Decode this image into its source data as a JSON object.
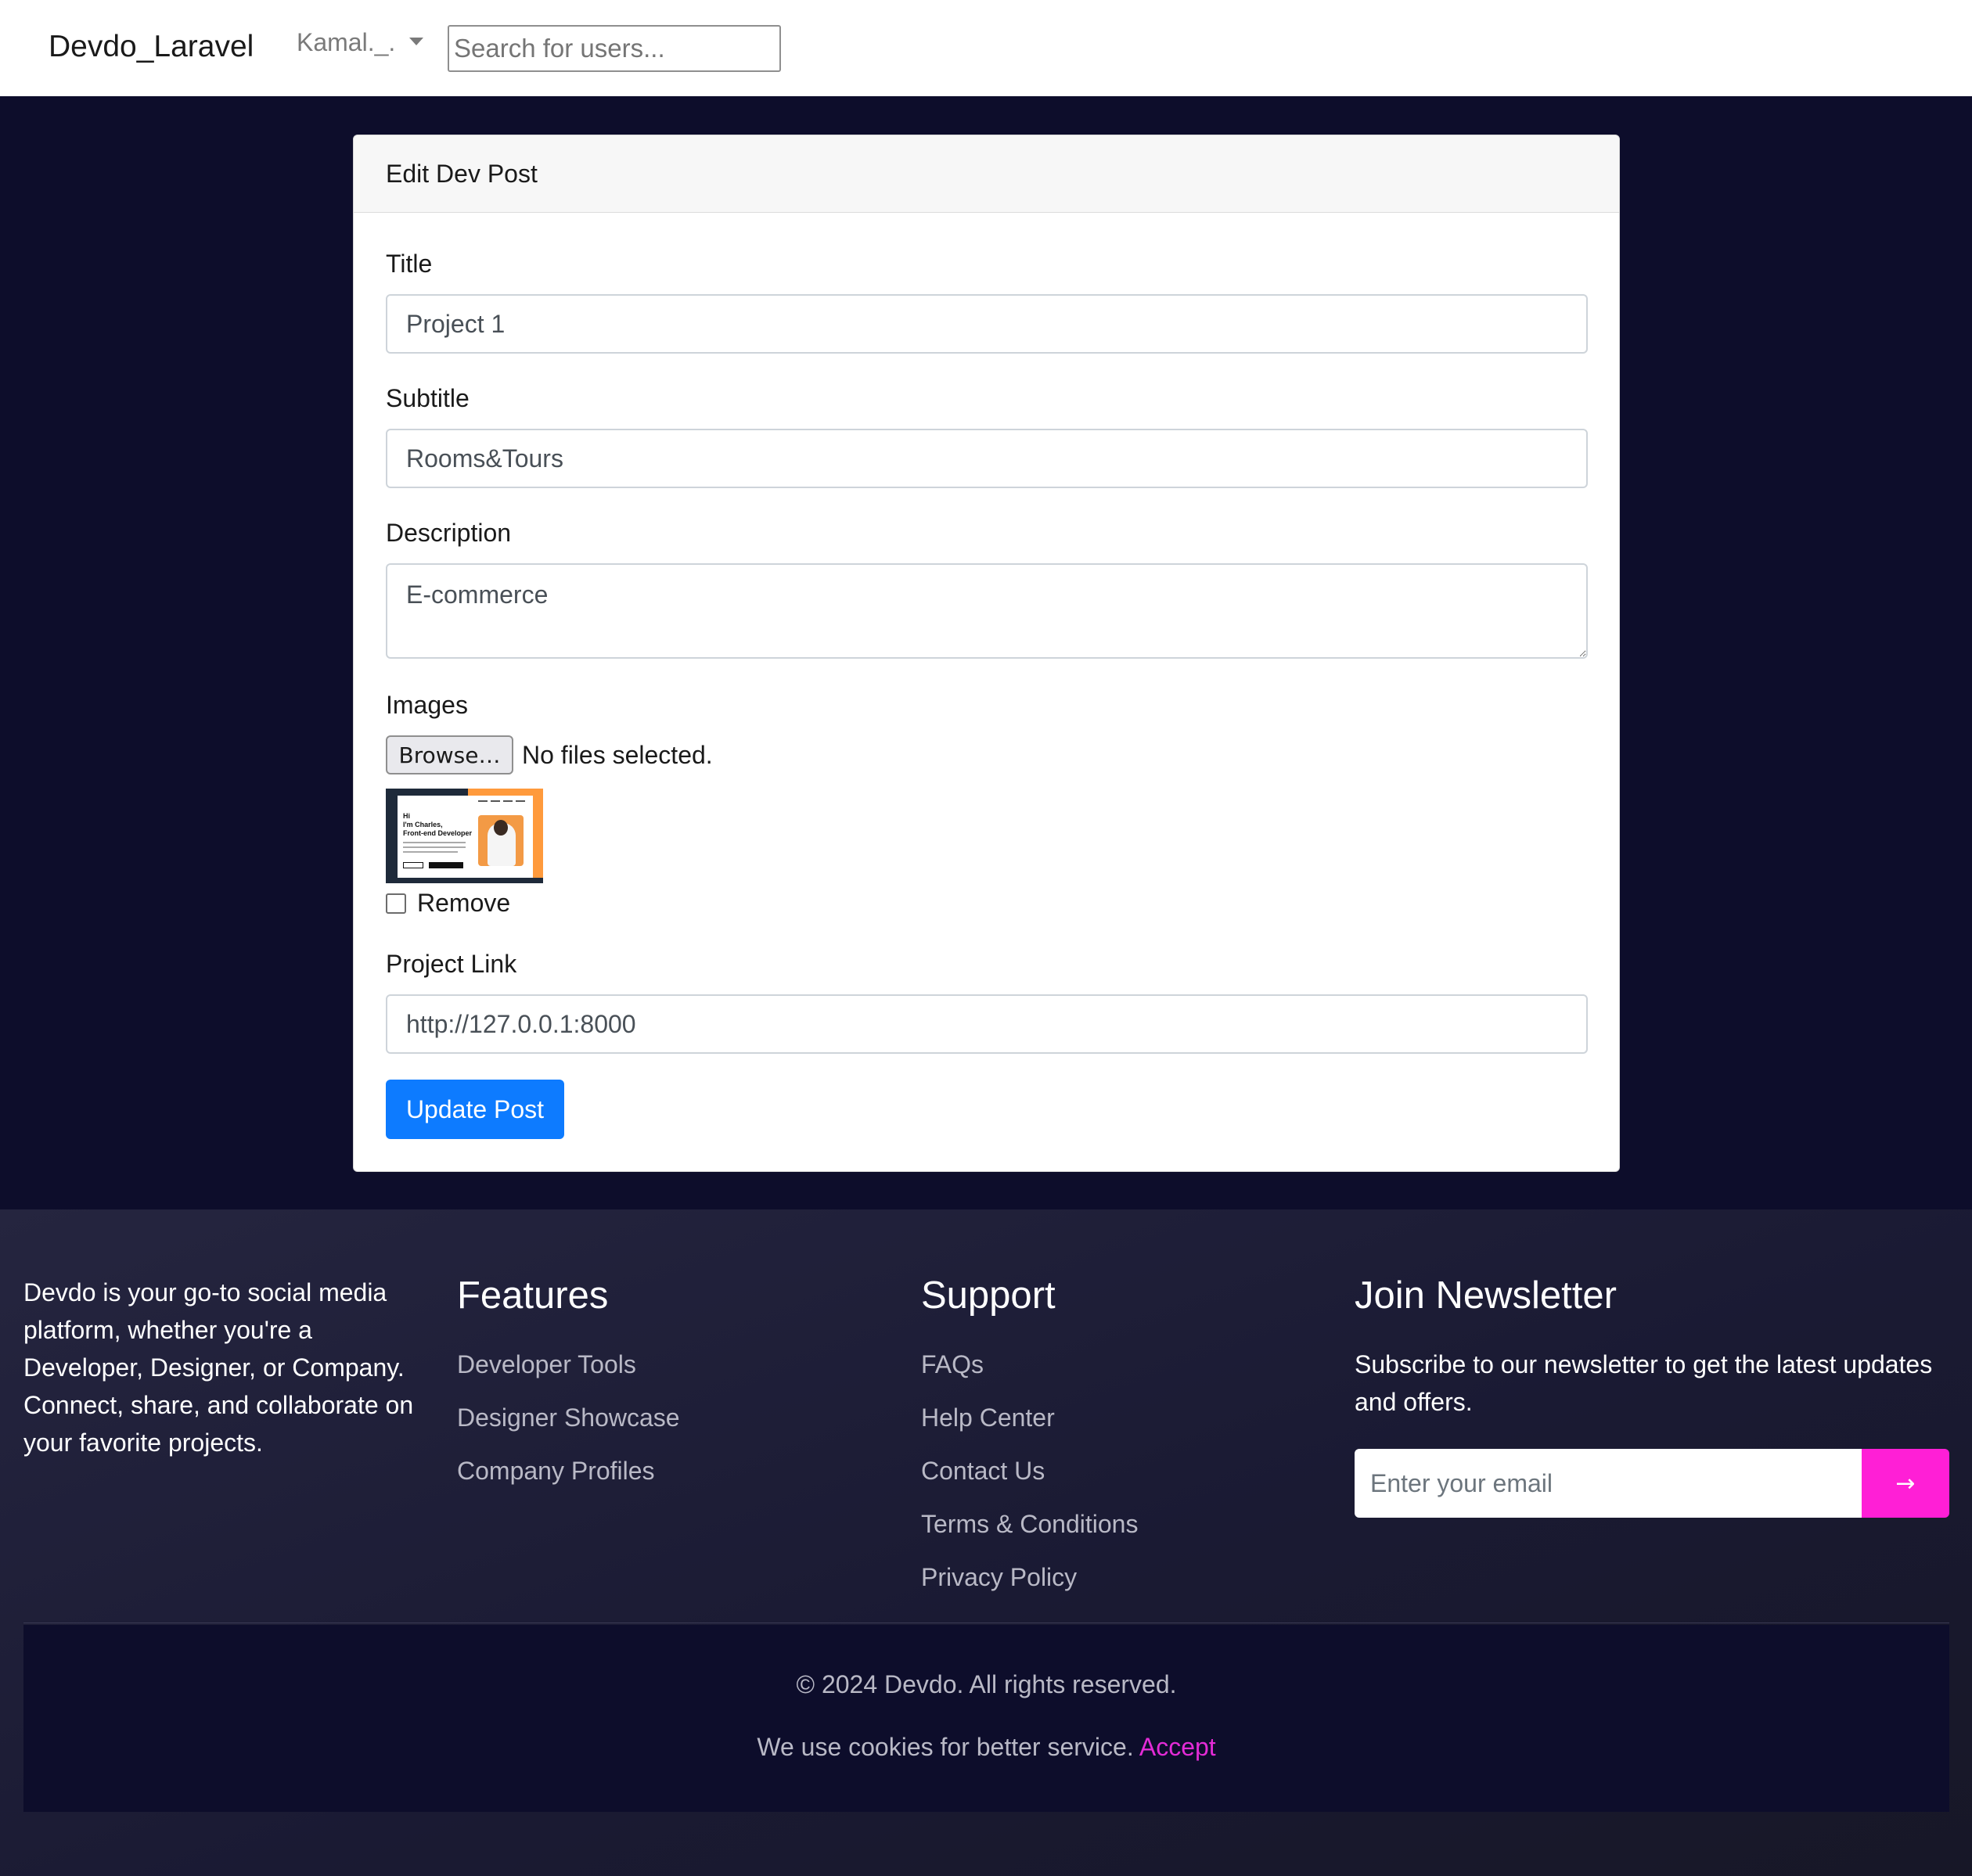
{
  "navbar": {
    "brand": "Devdo_Laravel",
    "user": "Kamal._.",
    "search_placeholder": "Search for users..."
  },
  "card": {
    "header": "Edit Dev Post",
    "title_label": "Title",
    "title_value": "Project 1",
    "subtitle_label": "Subtitle",
    "subtitle_value": "Rooms&Tours",
    "description_label": "Description",
    "description_value": "E-commerce",
    "images_label": "Images",
    "browse_label": "Browse…",
    "file_status": "No files selected.",
    "remove_label": "Remove",
    "remove_checked": false,
    "link_label": "Project Link",
    "link_value": "http://127.0.0.1:8000",
    "submit_label": "Update Post",
    "submit_color": "#0d7bff"
  },
  "thumbnail": {
    "greeting": "Hi",
    "line1": "I'm Charles,",
    "line2": "Front-end Developer"
  },
  "footer": {
    "about": "Devdo is your go-to social media platform, whether you're a Developer, Designer, or Company. Connect, share, and collaborate on your favorite projects.",
    "features": {
      "title": "Features",
      "links": [
        "Developer Tools",
        "Designer Showcase",
        "Company Profiles"
      ]
    },
    "support": {
      "title": "Support",
      "links": [
        "FAQs",
        "Help Center",
        "Contact Us",
        "Terms & Conditions",
        "Privacy Policy"
      ]
    },
    "newsletter": {
      "title": "Join Newsletter",
      "text": "Subscribe to our newsletter to get the latest updates and offers.",
      "email_placeholder": "Enter your email",
      "button_label": "→",
      "button_color": "#ff1fd6"
    },
    "copyright": "© 2024 Devdo. All rights reserved.",
    "cookie_text": "We use cookies for better service.",
    "cookie_accept": "Accept",
    "accent_color": "#e32bd6"
  },
  "colors": {
    "page_background": "#0d0d2b",
    "footer_background": "#1f1f38"
  }
}
